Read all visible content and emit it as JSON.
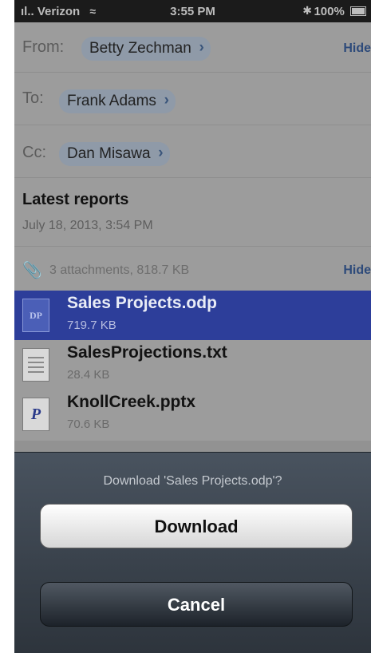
{
  "status_bar": {
    "carrier": "Verizon",
    "time": "3:55 PM",
    "battery": "100%"
  },
  "header": {
    "from_label": "From:",
    "from_name": "Betty Zechman",
    "hide_label": "Hide",
    "to_label": "To:",
    "to_name": "Frank Adams",
    "cc_label": "Cc:",
    "cc_name": "Dan Misawa",
    "subject": "Latest reports",
    "date": "July 18, 2013, 3:54 PM"
  },
  "attachments": {
    "summary": "3 attachments, 818.7 KB",
    "hide_label": "Hide",
    "items": [
      {
        "name": "Sales Projects.odp",
        "size": "719.7 KB",
        "icon": "odp-file-icon",
        "selected": true
      },
      {
        "name": "SalesProjections.txt",
        "size": "28.4 KB",
        "icon": "txt-file-icon",
        "selected": false
      },
      {
        "name": "KnollCreek.pptx",
        "size": "70.6 KB",
        "icon": "pptx-file-icon",
        "selected": false
      }
    ]
  },
  "action_sheet": {
    "title": "Download 'Sales Projects.odp'?",
    "download_label": "Download",
    "cancel_label": "Cancel"
  },
  "colors": {
    "selection": "#2d3e9a",
    "link": "#2d4a7a",
    "sheet": "#3c444e"
  }
}
